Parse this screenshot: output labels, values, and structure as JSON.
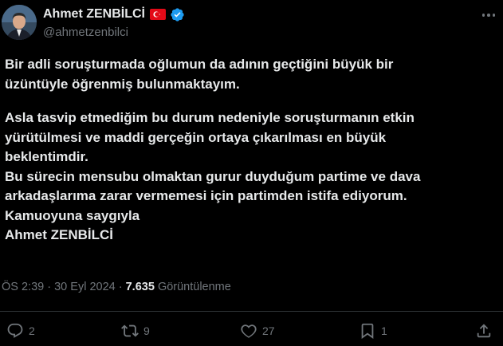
{
  "author": {
    "name": "Ahmet ZENBİLCİ",
    "handle": "@ahmetzenbilci",
    "flag_icon": "turkey-flag-icon",
    "verified_icon": "verified-badge-icon",
    "verified_color": "#1d9bf0"
  },
  "tweet": {
    "lines": [
      "Bir adli soruşturmada oğlumun da adının geçtiğini büyük bir",
      "üzüntüyle öğrenmiş bulunmaktayım.",
      "",
      "Asla tasvip etmediğim bu durum nedeniyle soruşturmanın etkin",
      "yürütülmesi ve maddi gerçeğin ortaya çıkarılması en büyük",
      "beklentimdir.",
      "Bu sürecin mensubu olmaktan gurur duyduğum partime ve dava",
      "arkadaşlarıma zarar vermemesi için partimden istifa ediyorum.",
      "Kamuoyuna saygıyla",
      "Ahmet ZENBİLCİ"
    ]
  },
  "meta": {
    "time": "ÖS 2:39",
    "separator": "·",
    "date": "30 Eyl 2024",
    "views": "7.635",
    "views_label": "Görüntülenme"
  },
  "actions": {
    "replies": "2",
    "reposts": "9",
    "likes": "27",
    "bookmarks": "1"
  },
  "colors": {
    "background": "#000000",
    "text": "#e7e9ea",
    "muted": "#71767b",
    "divider": "#2f3336",
    "accent": "#1d9bf0",
    "flag_red": "#e30a17"
  }
}
